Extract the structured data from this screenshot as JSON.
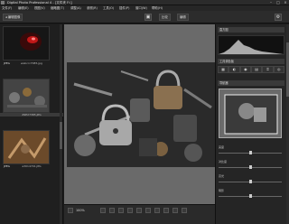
{
  "window": {
    "title": "Digital Photo Professional 4 - [文件夹 F:\\]"
  },
  "menu": {
    "items": [
      "文件(F)",
      "编辑(E)",
      "视图(V)",
      "缩略图(T)",
      "调整(A)",
      "参照(R)",
      "工具(O)",
      "插件(P)",
      "窗口(W)",
      "帮助(H)"
    ]
  },
  "toolbar": {
    "back_label": "编辑图像",
    "compare_label": "比较",
    "edit_label": "编辑"
  },
  "thumbnails": [
    {
      "filename": "webcrc7085.jpg",
      "badge": "JPEG"
    },
    {
      "filename": "Z9E27385.JPG",
      "badge": "JPEG"
    },
    {
      "filename": "a3014701.JPG",
      "badge": "JPEG"
    }
  ],
  "viewer": {
    "zoom": "100%"
  },
  "right_panel": {
    "histogram_title": "直方图",
    "tools_title": "工具调色板",
    "navigator_title": "导航器",
    "tool_tab_icons": [
      "rgb-icon",
      "tone-icon",
      "color-icon",
      "detail-icon",
      "crop-icon",
      "lens-icon"
    ],
    "labels": {
      "brightness": "亮度",
      "contrast": "对比度",
      "highlight": "高光",
      "shadow": "阴影"
    }
  }
}
